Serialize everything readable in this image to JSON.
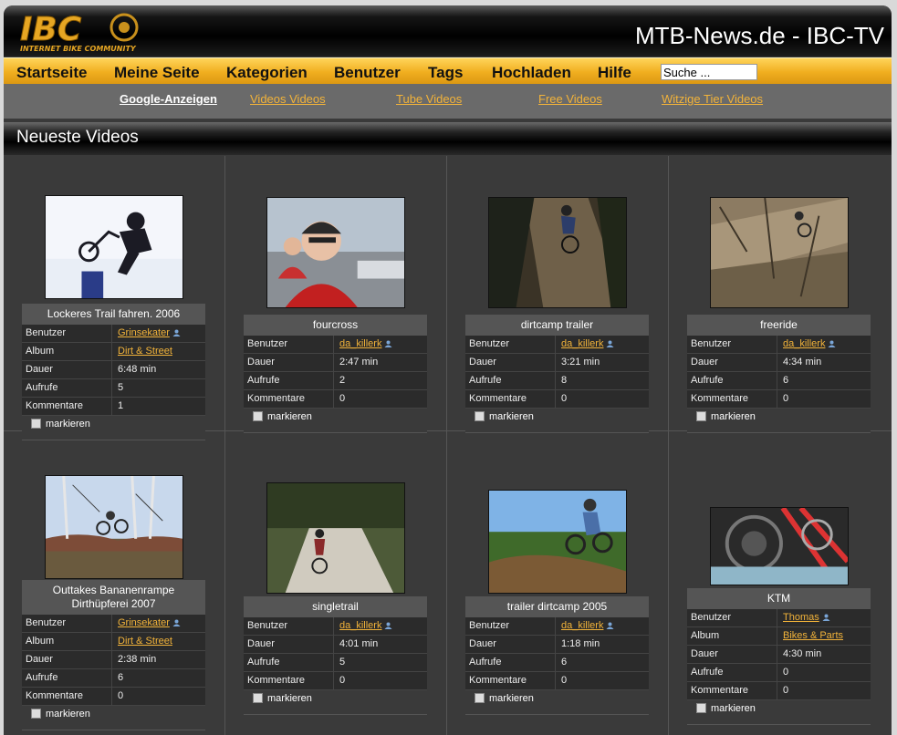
{
  "header": {
    "site_title": "MTB-News.de - IBC-TV",
    "logo_text": "IBC",
    "logo_subtext": "INTERNET BIKE COMMUNITY"
  },
  "nav": {
    "items": [
      {
        "label": "Startseite"
      },
      {
        "label": "Meine Seite"
      },
      {
        "label": "Kategorien"
      },
      {
        "label": "Benutzer"
      },
      {
        "label": "Tags"
      },
      {
        "label": "Hochladen"
      },
      {
        "label": "Hilfe"
      }
    ],
    "search_value": "Suche ..."
  },
  "subnav": {
    "links": [
      {
        "label": "Google-Anzeigen"
      },
      {
        "label": "Videos Videos"
      },
      {
        "label": "Tube Videos"
      },
      {
        "label": "Free Videos"
      },
      {
        "label": "Witzige Tier Videos"
      }
    ]
  },
  "section": {
    "title": "Neueste Videos"
  },
  "labels": {
    "user": "Benutzer",
    "album": "Album",
    "duration": "Dauer",
    "views": "Aufrufe",
    "comments": "Kommentare",
    "mark": "markieren"
  },
  "videos": [
    {
      "title": "Lockeres Trail fahren. 2006",
      "user": "Grinsekater",
      "album": "Dirt & Street",
      "duration": "6:48 min",
      "views": "5",
      "comments": "1"
    },
    {
      "title": "fourcross",
      "user": "da_killerk",
      "duration": "2:47 min",
      "views": "2",
      "comments": "0"
    },
    {
      "title": "dirtcamp trailer",
      "user": "da_killerk",
      "duration": "3:21 min",
      "views": "8",
      "comments": "0"
    },
    {
      "title": "freeride",
      "user": "da_killerk",
      "duration": "4:34 min",
      "views": "6",
      "comments": "0"
    },
    {
      "title": "Outtakes Bananenrampe Dirthüpferei 2007",
      "user": "Grinsekater",
      "album": "Dirt & Street",
      "duration": "2:38 min",
      "views": "6",
      "comments": "0"
    },
    {
      "title": "singletrail",
      "user": "da_killerk",
      "duration": "4:01 min",
      "views": "5",
      "comments": "0"
    },
    {
      "title": "trailer dirtcamp 2005",
      "user": "da_killerk",
      "duration": "1:18 min",
      "views": "6",
      "comments": "0"
    },
    {
      "title": "KTM",
      "user": "Thomas",
      "album": "Bikes & Parts",
      "duration": "4:30 min",
      "views": "0",
      "comments": "0"
    }
  ],
  "colors": {
    "accent": "#f2b33a",
    "nav_bg": "#f0ae1f",
    "page_bg": "#3a3a3a"
  }
}
